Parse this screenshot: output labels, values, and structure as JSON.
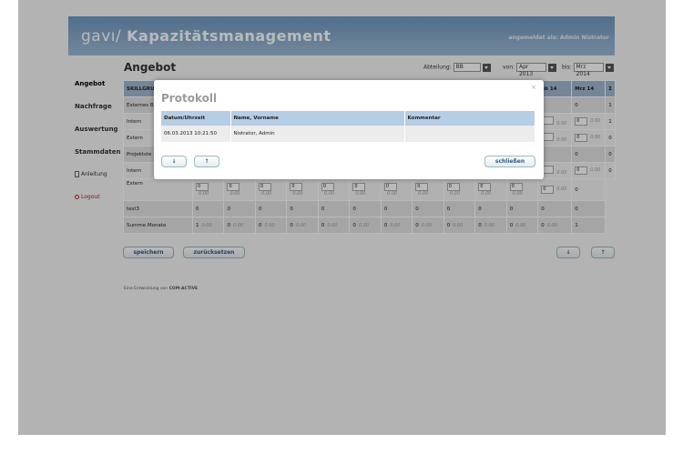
{
  "header": {
    "logo": "gavı",
    "separator": "/",
    "app_title": "Kapazitätsmanagement",
    "user_label": "angemeldet als: Admin Nistrator"
  },
  "sidebar": {
    "items": [
      {
        "label": "Angebot"
      },
      {
        "label": "Nachfrage"
      },
      {
        "label": "Auswertung"
      },
      {
        "label": "Stammdaten"
      },
      {
        "label": "Anleitung"
      },
      {
        "label": "Logout"
      }
    ]
  },
  "main": {
    "title": "Angebot",
    "filters": {
      "abteilung_label": "Abteilung:",
      "abteilung_value": "BB",
      "von_label": "von:",
      "von_value": "Apr 2013",
      "bis_label": "bis:",
      "bis_value": "Mrz 2014"
    },
    "table": {
      "header_first": "SKILLGRU",
      "header_feb": "eb 14",
      "header_mrz": "Mrz 14",
      "header_sum": "Σ",
      "rows": [
        {
          "label": "Externes B",
          "feb": "",
          "mrz": "0",
          "sum": "1"
        },
        {
          "label": "Intern",
          "feb": "0.00",
          "mrz": "0",
          "mrz_dec": "0.00",
          "sum": "1"
        },
        {
          "label": "Extern",
          "feb": "0.00",
          "mrz": "0",
          "mrz_dec": "0.00",
          "sum": "0"
        },
        {
          "label": "Projektste",
          "feb": "",
          "mrz": "0",
          "sum": "0"
        },
        {
          "label": "Intern",
          "feb": "0.00",
          "mrz": "0",
          "mrz_dec": "0.00",
          "sum": "0"
        }
      ],
      "extern_row": {
        "label": "Extern",
        "value": "0",
        "dec": "0.00",
        "sum": "0"
      },
      "test3_row": {
        "label": "test3",
        "value": "0",
        "sum": "0"
      },
      "sum_row": {
        "label": "Summe Monate",
        "first": "1",
        "value": "0",
        "dec": "0.00",
        "sum": "1"
      }
    },
    "buttons": {
      "save": "speichern",
      "reset": "zurücksetzen",
      "down": "↓",
      "up": "↑"
    },
    "credit_prefix": "Eine Entwicklung von",
    "credit_company": "COM-ACTIVE"
  },
  "modal": {
    "title": "Protokoll",
    "close": "×",
    "columns": [
      "Datum/Uhrzeit",
      "Name, Vorname",
      "Kommentar"
    ],
    "rows": [
      {
        "datetime": "06.03.2013 10:21:50",
        "name": "Nistrator, Admin",
        "comment": ""
      }
    ],
    "down": "↓",
    "up": "↑",
    "close_button": "schließen"
  }
}
